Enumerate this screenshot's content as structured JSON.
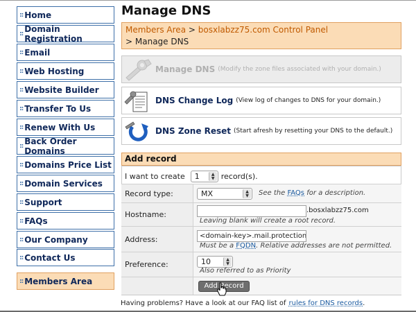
{
  "sidebar": {
    "items": [
      {
        "label": "Home"
      },
      {
        "label": "Domain Registration"
      },
      {
        "label": "Email"
      },
      {
        "label": "Web Hosting"
      },
      {
        "label": "Website Builder"
      },
      {
        "label": "Transfer To Us"
      },
      {
        "label": "Renew With Us"
      },
      {
        "label": "Back Order Domains"
      },
      {
        "label": "Domains Price List"
      },
      {
        "label": "Domain Services"
      },
      {
        "label": "Support"
      },
      {
        "label": "FAQs"
      },
      {
        "label": "Our Company"
      },
      {
        "label": "Contact Us"
      }
    ],
    "members": {
      "label": "Members Area"
    },
    "bullet": "::"
  },
  "main": {
    "title": "Manage DNS",
    "breadcrumb": {
      "members_area": "Members Area",
      "sep1": ">",
      "control_panel": "bosxlabzz75.com Control Panel",
      "sep2": ">",
      "current": "Manage DNS"
    },
    "actions": [
      {
        "title": "Manage DNS",
        "desc": "(Modify the zone files associated with your domain.)",
        "icon": "wrench-icon",
        "disabled": true
      },
      {
        "title": "DNS Change Log",
        "desc": "(View log of changes to DNS for your domain.)",
        "icon": "log-document-icon",
        "disabled": false
      },
      {
        "title": "DNS Zone Reset",
        "desc": "(Start afresh by resetting your DNS to the default.)",
        "icon": "reset-icon",
        "disabled": false
      }
    ]
  },
  "add_record": {
    "header": "Add record",
    "want_prefix": "I want to create",
    "count_value": "1",
    "want_suffix": "record(s).",
    "record_type": {
      "label": "Record type:",
      "value": "MX",
      "hint_prefix": "See the",
      "hint_link": "FAQs",
      "hint_suffix": "for a description."
    },
    "hostname": {
      "label": "Hostname:",
      "value": "",
      "suffix": ".bosxlabzz75.com",
      "hint": "Leaving blank will create a root record."
    },
    "address": {
      "label": "Address:",
      "value": "<domain-key>.mail.protection.o",
      "hint_prefix": "Must be a",
      "hint_link": "FQDN",
      "hint_suffix": ". Relative addresses are not permitted."
    },
    "preference": {
      "label": "Preference:",
      "value": "10",
      "hint": "Also referred to as Priority"
    },
    "submit_label": "Add Record"
  },
  "footer": {
    "text": "Having problems? Have a look at our FAQ list of",
    "link": "rules for DNS records",
    "period": "."
  },
  "colors": {
    "nav_border": "#3d6fa8",
    "nav_text": "#10285a",
    "highlight_bg": "#fbdcb6",
    "highlight_border": "#e0a060",
    "crumb_link": "#c05a00",
    "link": "#1a5aa0"
  }
}
